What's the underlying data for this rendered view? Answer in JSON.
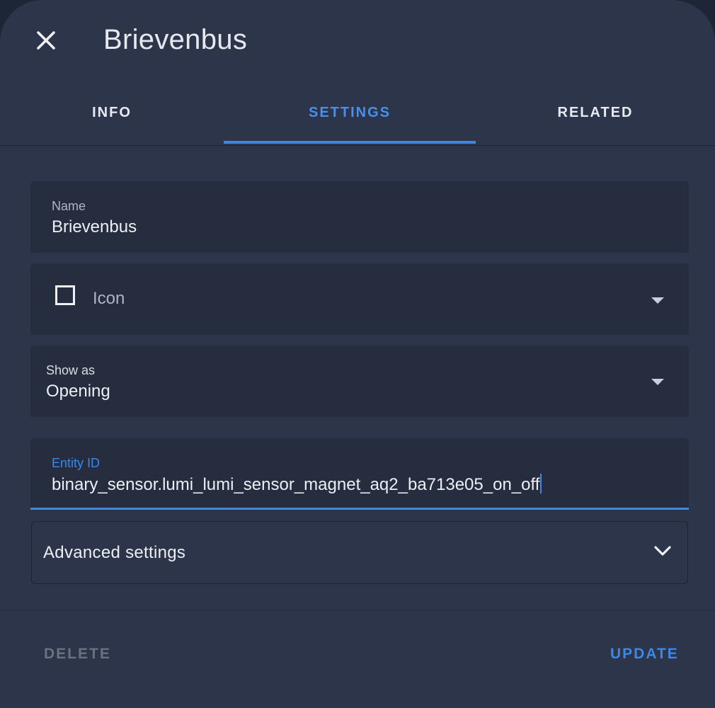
{
  "dialog": {
    "title": "Brievenbus",
    "close_icon": "close-icon"
  },
  "tabs": [
    {
      "label": "INFO",
      "active": false
    },
    {
      "label": "SETTINGS",
      "active": true
    },
    {
      "label": "RELATED",
      "active": false
    }
  ],
  "form": {
    "name": {
      "label": "Name",
      "value": "Brievenbus"
    },
    "icon": {
      "label": "Icon",
      "icon": "checkbox-outline-icon"
    },
    "show_as": {
      "label": "Show as",
      "value": "Opening"
    },
    "entity_id": {
      "label": "Entity ID",
      "value": "binary_sensor.lumi_lumi_sensor_magnet_aq2_ba713e05_on_off"
    }
  },
  "advanced": {
    "label": "Advanced settings"
  },
  "footer": {
    "delete_label": "DELETE",
    "update_label": "UPDATE"
  },
  "colors": {
    "background": "#2c3549",
    "field_background": "#262d3f",
    "accent": "#3b88e6",
    "disabled_text": "#6b7180"
  }
}
